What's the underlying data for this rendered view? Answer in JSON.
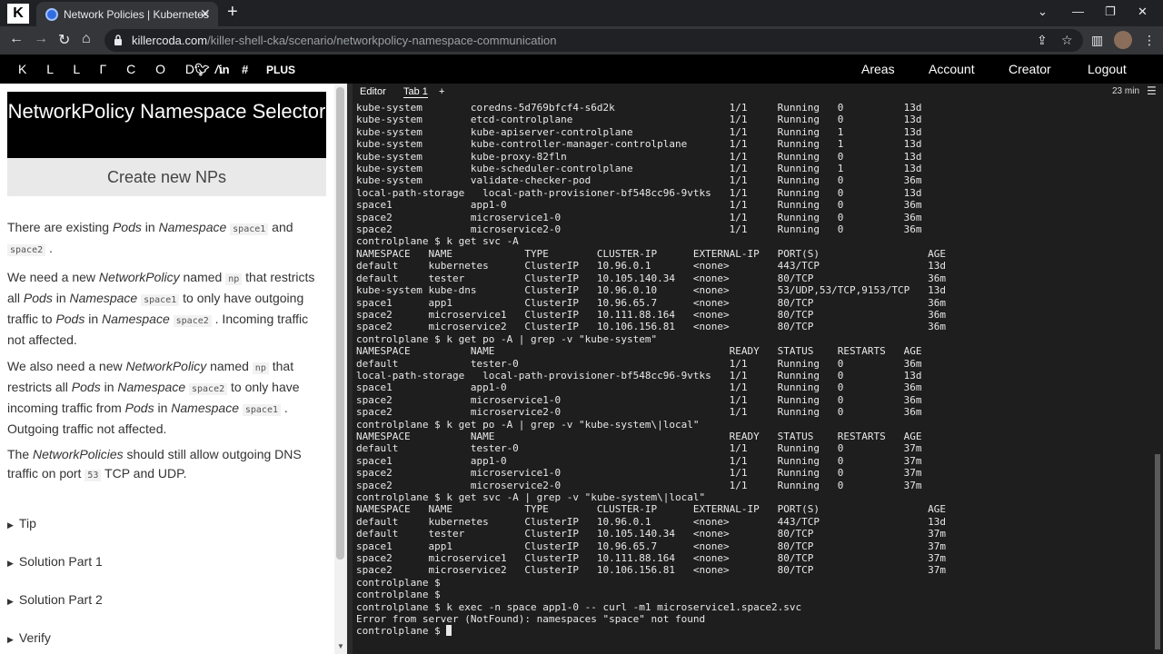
{
  "browser": {
    "tab_title": "Network Policies | Kubernetes",
    "url_host": "killercoda.com",
    "url_path": "/killer-shell-cka/scenario/networkpolicy-namespace-communication"
  },
  "site": {
    "logo": "KILLERCODA",
    "plus": "PLUS",
    "nav": [
      "Areas",
      "Account",
      "Creator",
      "Logout"
    ]
  },
  "scenario": {
    "title": "NetworkPolicy Namespace Selector",
    "subtitle": "Create new NPs",
    "p1": {
      "a": "There are existing ",
      "b": "Pods",
      "c": " in ",
      "d": "Namespace",
      "e": "space1",
      "f": " and ",
      "g": "space2",
      "h": " ."
    },
    "p2": {
      "a": "We need a new ",
      "b": "NetworkPolicy",
      "c": " named ",
      "d": "np",
      "e": " that restricts all ",
      "f": "Pods",
      "g": " in ",
      "h": "Namespace",
      "i": "space1",
      "j": " to only have outgoing traffic to ",
      "k": "Pods",
      "l": " in ",
      "m": "Namespace",
      "n": "space2",
      "o": " . Incoming traffic not affected."
    },
    "p3": {
      "a": "We also need a new ",
      "b": "NetworkPolicy",
      "c": " named ",
      "d": "np",
      "e": " that restricts all ",
      "f": "Pods",
      "g": " in ",
      "h": "Namespace",
      "i": "space2",
      "j": " to only have incoming traffic from ",
      "k": "Pods",
      "l": " in ",
      "m": "Namespace",
      "n": "space1",
      "o": " . Outgoing traffic not affected."
    },
    "p4": {
      "a": "The ",
      "b": "NetworkPolicies",
      "c": " should still allow outgoing DNS traffic on port ",
      "d": "53",
      "e": " TCP and UDP."
    },
    "details": [
      "Tip",
      "Solution Part 1",
      "Solution Part 2",
      "Verify"
    ]
  },
  "terminal": {
    "tabs": [
      "Editor",
      "Tab 1",
      "+"
    ],
    "timer": "23 min",
    "lines": [
      "kube-system        coredns-5d769bfcf4-s6d2k                   1/1     Running   0          13d",
      "kube-system        etcd-controlplane                          1/1     Running   0          13d",
      "kube-system        kube-apiserver-controlplane                1/1     Running   1          13d",
      "kube-system        kube-controller-manager-controlplane       1/1     Running   1          13d",
      "kube-system        kube-proxy-82fln                           1/1     Running   0          13d",
      "kube-system        kube-scheduler-controlplane                1/1     Running   1          13d",
      "kube-system        validate-checker-pod                       1/1     Running   0          36m",
      "local-path-storage   local-path-provisioner-bf548cc96-9vtks   1/1     Running   0          13d",
      "space1             app1-0                                     1/1     Running   0          36m",
      "space2             microservice1-0                            1/1     Running   0          36m",
      "space2             microservice2-0                            1/1     Running   0          36m",
      "controlplane $ k get svc -A",
      "NAMESPACE   NAME            TYPE        CLUSTER-IP      EXTERNAL-IP   PORT(S)                  AGE",
      "default     kubernetes      ClusterIP   10.96.0.1       <none>        443/TCP                  13d",
      "default     tester          ClusterIP   10.105.140.34   <none>        80/TCP                   36m",
      "kube-system kube-dns        ClusterIP   10.96.0.10      <none>        53/UDP,53/TCP,9153/TCP   13d",
      "space1      app1            ClusterIP   10.96.65.7      <none>        80/TCP                   36m",
      "space2      microservice1   ClusterIP   10.111.88.164   <none>        80/TCP                   36m",
      "space2      microservice2   ClusterIP   10.106.156.81   <none>        80/TCP                   36m",
      "controlplane $ k get po -A | grep -v \"kube-system\"",
      "NAMESPACE          NAME                                       READY   STATUS    RESTARTS   AGE",
      "default            tester-0                                   1/1     Running   0          36m",
      "local-path-storage   local-path-provisioner-bf548cc96-9vtks   1/1     Running   0          13d",
      "space1             app1-0                                     1/1     Running   0          36m",
      "space2             microservice1-0                            1/1     Running   0          36m",
      "space2             microservice2-0                            1/1     Running   0          36m",
      "controlplane $ k get po -A | grep -v \"kube-system\\|local\"",
      "NAMESPACE          NAME                                       READY   STATUS    RESTARTS   AGE",
      "default            tester-0                                   1/1     Running   0          37m",
      "space1             app1-0                                     1/1     Running   0          37m",
      "space2             microservice1-0                            1/1     Running   0          37m",
      "space2             microservice2-0                            1/1     Running   0          37m",
      "controlplane $ k get svc -A | grep -v \"kube-system\\|local\"",
      "NAMESPACE   NAME            TYPE        CLUSTER-IP      EXTERNAL-IP   PORT(S)                  AGE",
      "default     kubernetes      ClusterIP   10.96.0.1       <none>        443/TCP                  13d",
      "default     tester          ClusterIP   10.105.140.34   <none>        80/TCP                   37m",
      "space1      app1            ClusterIP   10.96.65.7      <none>        80/TCP                   37m",
      "space2      microservice1   ClusterIP   10.111.88.164   <none>        80/TCP                   37m",
      "space2      microservice2   ClusterIP   10.106.156.81   <none>        80/TCP                   37m",
      "controlplane $",
      "controlplane $",
      "controlplane $ k exec -n space app1-0 -- curl -m1 microservice1.space2.svc",
      "Error from server (NotFound): namespaces \"space\" not found"
    ],
    "prompt": "controlplane $ "
  }
}
